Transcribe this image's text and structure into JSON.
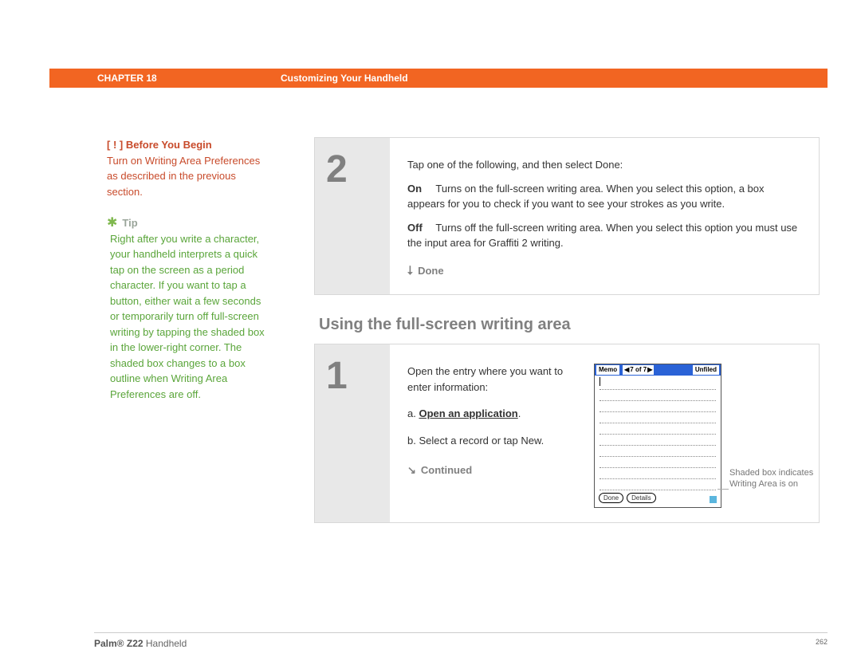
{
  "header": {
    "chapter_label": "CHAPTER 18",
    "chapter_title": "Customizing Your Handheld"
  },
  "sidebar": {
    "before_begin_marker": "[ ! ]",
    "before_begin_heading": "Before You Begin",
    "before_begin_body": "Turn on Writing Area Preferences as described in the previous section.",
    "tip_label": "Tip",
    "tip_body": "Right after you write a character, your handheld interprets a quick tap on the screen as a period character. If you want to tap a button, either wait a few seconds or temporarily turn off full-screen writing by tapping the shaded box in the lower-right corner. The shaded box changes to a box outline when Writing Area Preferences are off."
  },
  "step2": {
    "num": "2",
    "intro": "Tap one of the following, and then select Done:",
    "on_label": "On",
    "on_text": "Turns on the full-screen writing area. When you select this option, a box appears for you to check if you want to see your strokes as you write.",
    "off_label": "Off",
    "off_text": "Turns off the full-screen writing area. When you select this option you must use the input area for Graffiti 2 writing.",
    "done_label": "Done"
  },
  "section_title": "Using the full-screen writing area",
  "step1": {
    "num": "1",
    "intro": "Open the entry where you want to enter information:",
    "sub_a_prefix": "a.",
    "sub_a_link": "Open an application",
    "sub_a_suffix": ".",
    "sub_b": "b.  Select a record or tap New.",
    "continued_label": "Continued"
  },
  "memo": {
    "title": "Memo",
    "nav_text": "7 of 7",
    "category": "Unfiled",
    "done_btn": "Done",
    "details_btn": "Details"
  },
  "callout": "Shaded box indicates Writing Area is on",
  "footer": {
    "product_bold": "Palm® Z22",
    "product_rest": " Handheld",
    "page": "262"
  }
}
